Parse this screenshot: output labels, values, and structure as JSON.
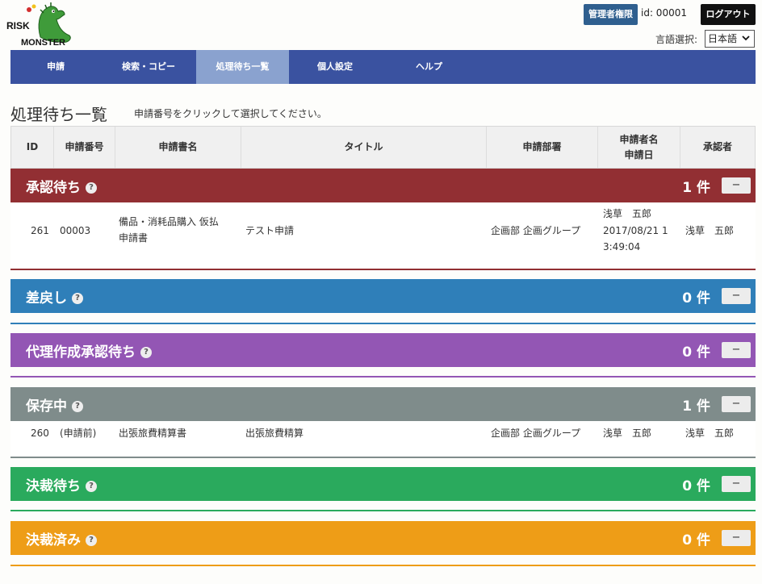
{
  "header": {
    "logo_text_line1": "RISK",
    "logo_text_line2": "MONSTER",
    "admin_badge": "管理者権限",
    "user_id": "id: 00001",
    "logout": "ログアウト",
    "lang_label": "言語選択:",
    "lang_value": "日本語"
  },
  "nav": {
    "items": [
      {
        "label": "申請"
      },
      {
        "label": "検索・コピー"
      },
      {
        "label": "処理待ち一覧"
      },
      {
        "label": "個人設定"
      },
      {
        "label": "ヘルプ"
      }
    ]
  },
  "page": {
    "title": "処理待ち一覧",
    "hint": "申請番号をクリックして選択してください。"
  },
  "table": {
    "headers": [
      "ID",
      "申請番号",
      "申請書名",
      "タイトル",
      "申請部署",
      "申請者名",
      "申請日",
      "承認者"
    ]
  },
  "sections": [
    {
      "title": "承認待ち",
      "count": "1 件",
      "toggle": "−",
      "help": "?",
      "color": "#922f33",
      "rows": [
        {
          "id": "261",
          "number": "00003",
          "form_l1": "備品・消耗品購入 仮払",
          "form_l2": "申請書",
          "title": "テスト申請",
          "dept": "企画部 企画グループ",
          "applicant": "浅草　五郎",
          "date_l1": "2017/08/21 1",
          "date_l2": "3:49:04",
          "approver": "浅草　五郎"
        }
      ]
    },
    {
      "title": "差戻し",
      "count": "0 件",
      "toggle": "−",
      "help": "?",
      "color": "#2f7fb9",
      "rows": []
    },
    {
      "title": "代理作成承認待ち",
      "count": "0 件",
      "toggle": "−",
      "help": "?",
      "color": "#9356b4",
      "rows": []
    },
    {
      "title": "保存中",
      "count": "1 件",
      "toggle": "−",
      "help": "?",
      "color": "#7f8c8b",
      "rows": [
        {
          "id": "260",
          "number": "(申請前)",
          "form_l1": "出張旅費精算書",
          "title": "出張旅費精算",
          "dept": "企画部 企画グループ",
          "applicant": "浅草　五郎",
          "approver": "浅草　五郎"
        }
      ]
    },
    {
      "title": "決裁待ち",
      "count": "0 件",
      "toggle": "−",
      "help": "?",
      "color": "#2aaa5d",
      "rows": []
    },
    {
      "title": "決裁済み",
      "count": "0 件",
      "toggle": "−",
      "help": "?",
      "color": "#ee9d17",
      "rows": []
    }
  ]
}
